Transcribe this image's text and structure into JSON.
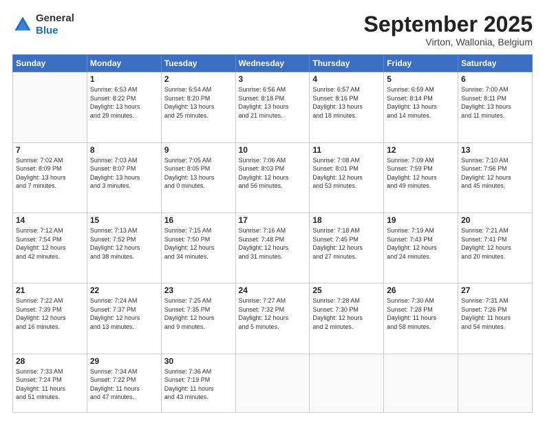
{
  "header": {
    "logo_line1": "General",
    "logo_line2": "Blue",
    "month": "September 2025",
    "location": "Virton, Wallonia, Belgium"
  },
  "weekdays": [
    "Sunday",
    "Monday",
    "Tuesday",
    "Wednesday",
    "Thursday",
    "Friday",
    "Saturday"
  ],
  "weeks": [
    [
      {
        "day": "",
        "info": ""
      },
      {
        "day": "1",
        "info": "Sunrise: 6:53 AM\nSunset: 8:22 PM\nDaylight: 13 hours\nand 29 minutes."
      },
      {
        "day": "2",
        "info": "Sunrise: 6:54 AM\nSunset: 8:20 PM\nDaylight: 13 hours\nand 25 minutes."
      },
      {
        "day": "3",
        "info": "Sunrise: 6:56 AM\nSunset: 8:18 PM\nDaylight: 13 hours\nand 21 minutes."
      },
      {
        "day": "4",
        "info": "Sunrise: 6:57 AM\nSunset: 8:16 PM\nDaylight: 13 hours\nand 18 minutes."
      },
      {
        "day": "5",
        "info": "Sunrise: 6:59 AM\nSunset: 8:14 PM\nDaylight: 13 hours\nand 14 minutes."
      },
      {
        "day": "6",
        "info": "Sunrise: 7:00 AM\nSunset: 8:11 PM\nDaylight: 13 hours\nand 11 minutes."
      }
    ],
    [
      {
        "day": "7",
        "info": "Sunrise: 7:02 AM\nSunset: 8:09 PM\nDaylight: 13 hours\nand 7 minutes."
      },
      {
        "day": "8",
        "info": "Sunrise: 7:03 AM\nSunset: 8:07 PM\nDaylight: 13 hours\nand 3 minutes."
      },
      {
        "day": "9",
        "info": "Sunrise: 7:05 AM\nSunset: 8:05 PM\nDaylight: 13 hours\nand 0 minutes."
      },
      {
        "day": "10",
        "info": "Sunrise: 7:06 AM\nSunset: 8:03 PM\nDaylight: 12 hours\nand 56 minutes."
      },
      {
        "day": "11",
        "info": "Sunrise: 7:08 AM\nSunset: 8:01 PM\nDaylight: 12 hours\nand 53 minutes."
      },
      {
        "day": "12",
        "info": "Sunrise: 7:09 AM\nSunset: 7:59 PM\nDaylight: 12 hours\nand 49 minutes."
      },
      {
        "day": "13",
        "info": "Sunrise: 7:10 AM\nSunset: 7:56 PM\nDaylight: 12 hours\nand 45 minutes."
      }
    ],
    [
      {
        "day": "14",
        "info": "Sunrise: 7:12 AM\nSunset: 7:54 PM\nDaylight: 12 hours\nand 42 minutes."
      },
      {
        "day": "15",
        "info": "Sunrise: 7:13 AM\nSunset: 7:52 PM\nDaylight: 12 hours\nand 38 minutes."
      },
      {
        "day": "16",
        "info": "Sunrise: 7:15 AM\nSunset: 7:50 PM\nDaylight: 12 hours\nand 34 minutes."
      },
      {
        "day": "17",
        "info": "Sunrise: 7:16 AM\nSunset: 7:48 PM\nDaylight: 12 hours\nand 31 minutes."
      },
      {
        "day": "18",
        "info": "Sunrise: 7:18 AM\nSunset: 7:45 PM\nDaylight: 12 hours\nand 27 minutes."
      },
      {
        "day": "19",
        "info": "Sunrise: 7:19 AM\nSunset: 7:43 PM\nDaylight: 12 hours\nand 24 minutes."
      },
      {
        "day": "20",
        "info": "Sunrise: 7:21 AM\nSunset: 7:41 PM\nDaylight: 12 hours\nand 20 minutes."
      }
    ],
    [
      {
        "day": "21",
        "info": "Sunrise: 7:22 AM\nSunset: 7:39 PM\nDaylight: 12 hours\nand 16 minutes."
      },
      {
        "day": "22",
        "info": "Sunrise: 7:24 AM\nSunset: 7:37 PM\nDaylight: 12 hours\nand 13 minutes."
      },
      {
        "day": "23",
        "info": "Sunrise: 7:25 AM\nSunset: 7:35 PM\nDaylight: 12 hours\nand 9 minutes."
      },
      {
        "day": "24",
        "info": "Sunrise: 7:27 AM\nSunset: 7:32 PM\nDaylight: 12 hours\nand 5 minutes."
      },
      {
        "day": "25",
        "info": "Sunrise: 7:28 AM\nSunset: 7:30 PM\nDaylight: 12 hours\nand 2 minutes."
      },
      {
        "day": "26",
        "info": "Sunrise: 7:30 AM\nSunset: 7:28 PM\nDaylight: 11 hours\nand 58 minutes."
      },
      {
        "day": "27",
        "info": "Sunrise: 7:31 AM\nSunset: 7:26 PM\nDaylight: 11 hours\nand 54 minutes."
      }
    ],
    [
      {
        "day": "28",
        "info": "Sunrise: 7:33 AM\nSunset: 7:24 PM\nDaylight: 11 hours\nand 51 minutes."
      },
      {
        "day": "29",
        "info": "Sunrise: 7:34 AM\nSunset: 7:22 PM\nDaylight: 11 hours\nand 47 minutes."
      },
      {
        "day": "30",
        "info": "Sunrise: 7:36 AM\nSunset: 7:19 PM\nDaylight: 11 hours\nand 43 minutes."
      },
      {
        "day": "",
        "info": ""
      },
      {
        "day": "",
        "info": ""
      },
      {
        "day": "",
        "info": ""
      },
      {
        "day": "",
        "info": ""
      }
    ]
  ]
}
